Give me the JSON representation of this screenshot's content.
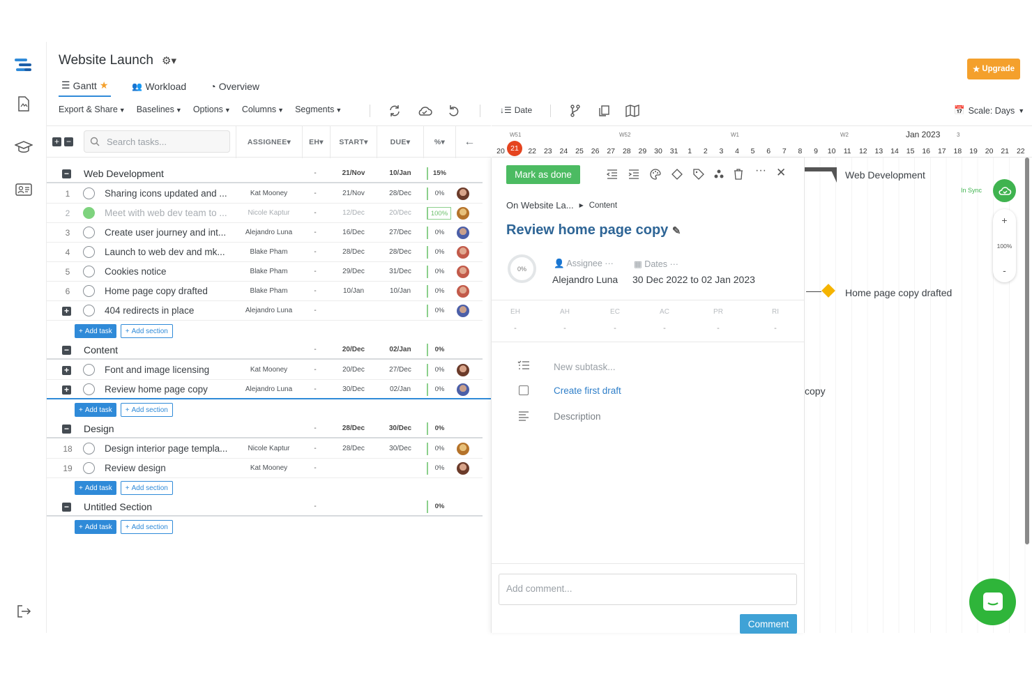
{
  "project": {
    "title": "Website Launch"
  },
  "tabs": [
    {
      "label": "Gantt"
    },
    {
      "label": "Workload"
    },
    {
      "label": "Overview"
    }
  ],
  "toolbar": {
    "export": "Export & Share",
    "baselines": "Baselines",
    "options": "Options",
    "columns": "Columns",
    "segments": "Segments",
    "sort": "Date",
    "scale": "Scale: Days"
  },
  "upgrade": "Upgrade",
  "search": {
    "placeholder": "Search tasks..."
  },
  "columns": {
    "assignee": "ASSIGNEE",
    "eh": "EH",
    "start": "START",
    "due": "DUE",
    "pct": "%"
  },
  "sections": [
    {
      "name": "Web Development",
      "eh": "-",
      "start": "21/Nov",
      "due": "10/Jan",
      "pct": "15%"
    },
    {
      "name": "Content",
      "eh": "-",
      "start": "20/Dec",
      "due": "02/Jan",
      "pct": "0%"
    },
    {
      "name": "Design",
      "eh": "-",
      "start": "28/Dec",
      "due": "30/Dec",
      "pct": "0%"
    },
    {
      "name": "Untitled Section",
      "eh": "-",
      "start": "",
      "due": "",
      "pct": "0%"
    }
  ],
  "tasks": [
    {
      "num": "1",
      "name": "Sharing icons updated and ...",
      "assignee": "Kat Mooney",
      "eh": "-",
      "start": "21/Nov",
      "due": "28/Dec",
      "pct": "0%"
    },
    {
      "num": "2",
      "name": "Meet with web dev team to ...",
      "assignee": "Nicole Kaptur",
      "eh": "-",
      "start": "12/Dec",
      "due": "20/Dec",
      "pct": "100%"
    },
    {
      "num": "3",
      "name": "Create user journey and int...",
      "assignee": "Alejandro Luna",
      "eh": "-",
      "start": "16/Dec",
      "due": "27/Dec",
      "pct": "0%"
    },
    {
      "num": "4",
      "name": "Launch to web dev and mk...",
      "assignee": "Blake Pham",
      "eh": "-",
      "start": "28/Dec",
      "due": "28/Dec",
      "pct": "0%"
    },
    {
      "num": "5",
      "name": "Cookies notice",
      "assignee": "Blake Pham",
      "eh": "-",
      "start": "29/Dec",
      "due": "31/Dec",
      "pct": "0%"
    },
    {
      "num": "6",
      "name": "Home page copy drafted",
      "assignee": "Blake Pham",
      "eh": "-",
      "start": "10/Jan",
      "due": "10/Jan",
      "pct": "0%"
    },
    {
      "num": "",
      "name": "404 redirects in place",
      "assignee": "Alejandro Luna",
      "eh": "-",
      "start": "",
      "due": "",
      "pct": "0%"
    },
    {
      "num": "",
      "name": "Font and image licensing",
      "assignee": "Kat Mooney",
      "eh": "-",
      "start": "20/Dec",
      "due": "27/Dec",
      "pct": "0%"
    },
    {
      "num": "",
      "name": "Review home page copy",
      "assignee": "Alejandro Luna",
      "eh": "-",
      "start": "30/Dec",
      "due": "02/Jan",
      "pct": "0%"
    },
    {
      "num": "18",
      "name": "Design interior page templa...",
      "assignee": "Nicole Kaptur",
      "eh": "-",
      "start": "28/Dec",
      "due": "30/Dec",
      "pct": "0%"
    },
    {
      "num": "19",
      "name": "Review design",
      "assignee": "Kat Mooney",
      "eh": "-",
      "start": "",
      "due": "",
      "pct": "0%"
    }
  ],
  "add": {
    "task": "Add task",
    "section": "Add section"
  },
  "panel": {
    "mark_done": "Mark as done",
    "breadcrumb_project": "On Website La...",
    "breadcrumb_section": "Content",
    "title": "Review home page copy",
    "progress": "0%",
    "assignee_label": "Assignee",
    "assignee_value": "Alejandro Luna",
    "dates_label": "Dates",
    "dates_value": "30 Dec 2022 to 02 Jan 2023",
    "metrics": [
      {
        "k": "EH",
        "v": "-"
      },
      {
        "k": "AH",
        "v": "-"
      },
      {
        "k": "EC",
        "v": "-"
      },
      {
        "k": "AC",
        "v": "-"
      },
      {
        "k": "PR",
        "v": "-"
      },
      {
        "k": "RI",
        "v": "-"
      }
    ],
    "new_subtask": "New subtask...",
    "subtask": "Create first draft",
    "description": "Description",
    "comment_placeholder": "Add comment...",
    "comment_button": "Comment"
  },
  "timeline": {
    "weeks": [
      "W51",
      "W52",
      "W1",
      "W2",
      "3"
    ],
    "month": "Jan 2023",
    "days": [
      "20",
      "21",
      "22",
      "23",
      "24",
      "25",
      "26",
      "27",
      "28",
      "29",
      "30",
      "31",
      "1",
      "2",
      "3",
      "4",
      "5",
      "6",
      "7",
      "8",
      "9",
      "10",
      "11",
      "12",
      "13",
      "14",
      "15",
      "16",
      "17",
      "18",
      "19",
      "20",
      "21",
      "22"
    ],
    "today": "21"
  },
  "chart_labels": {
    "section": "Web Development",
    "milestone": "Home page copy drafted",
    "partial": "copy"
  },
  "sync": {
    "label": "In Sync"
  },
  "zoom": {
    "level": "100%",
    "plus": "+",
    "minus": "-"
  },
  "colors": {
    "accent": "#2f8ad8",
    "done": "#4cbb62",
    "today": "#e5441f",
    "upgrade": "#f4a02c",
    "milestone": "#f5b400"
  }
}
